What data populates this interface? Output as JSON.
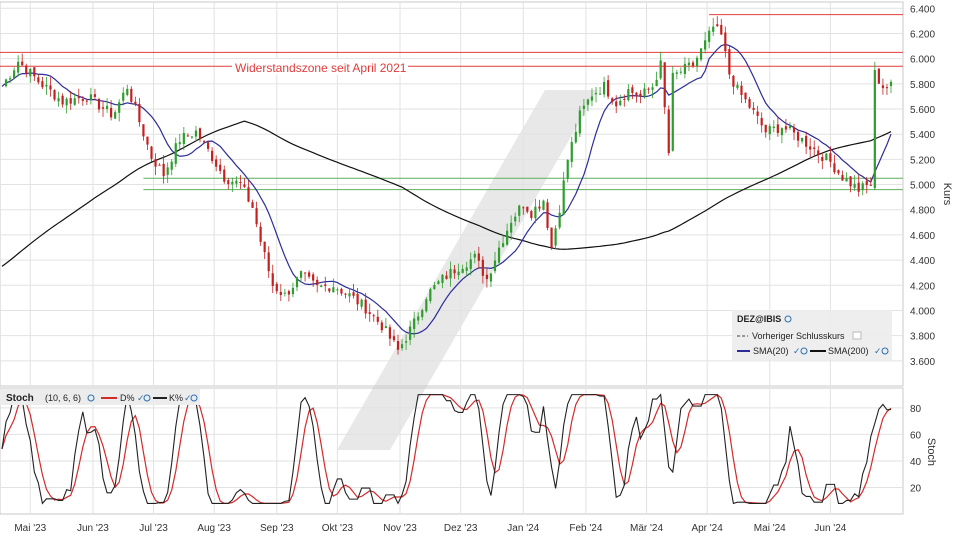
{
  "chart_data": [
    {
      "type": "candlestick",
      "title": "",
      "ylabel": "Kurs",
      "ylim": [
        3.4,
        6.45
      ],
      "yticks": [
        "6.400",
        "6.200",
        "6.000",
        "5.800",
        "5.600",
        "5.400",
        "5.200",
        "5.000",
        "4.800",
        "4.600",
        "4.400",
        "4.200",
        "4.000",
        "3.800",
        "3.600"
      ],
      "ytick_values": [
        6.4,
        6.2,
        6.0,
        5.8,
        5.6,
        5.4,
        5.2,
        5.0,
        4.8,
        4.6,
        4.4,
        4.2,
        4.0,
        3.8,
        3.6
      ],
      "xticks": [
        "Mai '23",
        "Jun '23",
        "Jul '23",
        "Aug '23",
        "Sep '23",
        "Okt '23",
        "Nov '23",
        "Dez '23",
        "Jan '24",
        "Feb '24",
        "Mär '24",
        "Apr '24",
        "Mai '24",
        "Jun '24"
      ],
      "grid": true,
      "close_anchors": [
        [
          0,
          5.78
        ],
        [
          8,
          5.98
        ],
        [
          18,
          5.82
        ],
        [
          30,
          5.66
        ],
        [
          42,
          5.7
        ],
        [
          55,
          5.55
        ],
        [
          62,
          5.78
        ],
        [
          68,
          5.5
        ],
        [
          74,
          5.22
        ],
        [
          80,
          5.08
        ],
        [
          88,
          5.36
        ],
        [
          96,
          5.42
        ],
        [
          104,
          5.22
        ],
        [
          110,
          5.06
        ],
        [
          118,
          5.0
        ],
        [
          124,
          4.82
        ],
        [
          128,
          4.55
        ],
        [
          134,
          4.2
        ],
        [
          140,
          4.12
        ],
        [
          148,
          4.28
        ],
        [
          156,
          4.18
        ],
        [
          164,
          4.2
        ],
        [
          172,
          4.12
        ],
        [
          180,
          4.02
        ],
        [
          188,
          3.88
        ],
        [
          196,
          3.68
        ],
        [
          204,
          3.9
        ],
        [
          210,
          4.12
        ],
        [
          218,
          4.25
        ],
        [
          226,
          4.35
        ],
        [
          234,
          4.42
        ],
        [
          240,
          4.25
        ],
        [
          246,
          4.5
        ],
        [
          252,
          4.72
        ],
        [
          258,
          4.85
        ],
        [
          262,
          4.78
        ],
        [
          268,
          4.88
        ],
        [
          272,
          4.5
        ],
        [
          276,
          4.82
        ],
        [
          280,
          5.2
        ],
        [
          286,
          5.55
        ],
        [
          292,
          5.72
        ],
        [
          298,
          5.78
        ],
        [
          304,
          5.65
        ],
        [
          310,
          5.75
        ],
        [
          316,
          5.7
        ],
        [
          322,
          5.78
        ],
        [
          326,
          5.95
        ],
        [
          330,
          5.25
        ],
        [
          332,
          5.85
        ],
        [
          336,
          5.9
        ],
        [
          342,
          5.95
        ],
        [
          348,
          6.12
        ],
        [
          352,
          6.25
        ],
        [
          356,
          6.18
        ],
        [
          360,
          5.88
        ],
        [
          364,
          5.75
        ],
        [
          370,
          5.62
        ],
        [
          378,
          5.42
        ],
        [
          386,
          5.46
        ],
        [
          394,
          5.38
        ],
        [
          402,
          5.28
        ],
        [
          410,
          5.18
        ],
        [
          416,
          5.06
        ],
        [
          424,
          4.96
        ],
        [
          430,
          5.0
        ],
        [
          432,
          5.88
        ],
        [
          436,
          5.78
        ]
      ],
      "series": [
        {
          "name": "DEZ@IBIS",
          "type": "candlestick",
          "color_up": "#2e9d2e",
          "color_down": "#c42020"
        },
        {
          "name": "SMA(20)",
          "type": "line",
          "color": "#2d2d99"
        },
        {
          "name": "SMA(200)",
          "type": "line",
          "color": "#111111"
        }
      ],
      "horizontal_lines": [
        {
          "y": 6.35,
          "color": "#e23b3b"
        },
        {
          "y": 6.05,
          "color": "#e23b3b"
        },
        {
          "y": 5.94,
          "color": "#e23b3b"
        },
        {
          "y": 5.05,
          "color": "#5fae5f"
        },
        {
          "y": 4.96,
          "color": "#5fae5f"
        }
      ],
      "annotations": [
        {
          "text": "Widerstandszone seit April 2021",
          "color": "#e23b3b"
        }
      ],
      "legend": {
        "placement": "bottom-right",
        "symbol": "DEZ@IBIS",
        "prev_close": "Vorheriger Schlusskurs",
        "sma20": "SMA(20)",
        "sma200": "SMA(200)"
      },
      "colors": {
        "up": "#2e9d2e",
        "down": "#c42020",
        "sma20": "#2d2d99",
        "sma200": "#111111",
        "resistance": "#e23b3b",
        "support": "#5fae5f"
      }
    },
    {
      "type": "line",
      "title": "Stoch",
      "params": "(10, 6, 6)",
      "ylabel": "Stoch",
      "ylim": [
        0,
        95
      ],
      "yticks": [
        "80",
        "60",
        "40",
        "20"
      ],
      "ytick_values": [
        80,
        60,
        40,
        20
      ],
      "legend": {
        "d": "D%",
        "k": "K%"
      },
      "series": [
        {
          "name": "D%",
          "color": "#d42a2a"
        },
        {
          "name": "K%",
          "color": "#222222"
        }
      ]
    }
  ],
  "watermark": "/"
}
